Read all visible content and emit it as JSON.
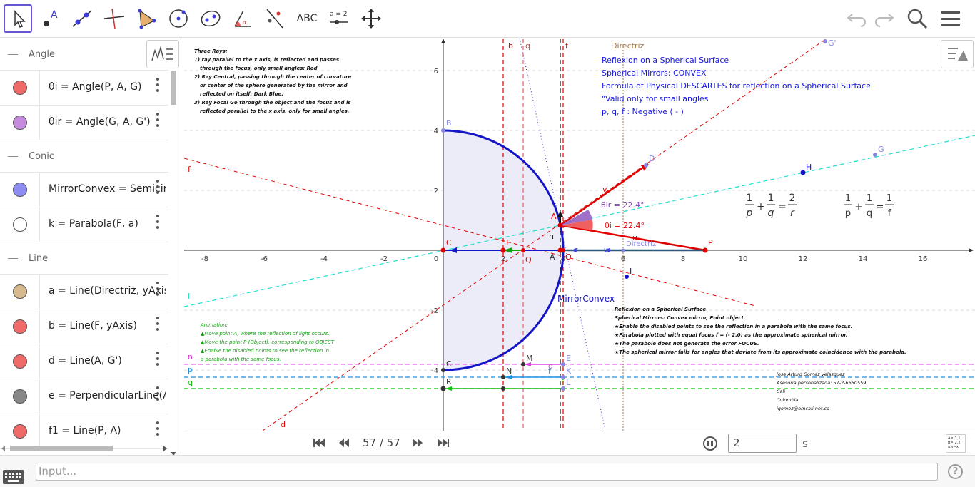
{
  "toolbar": {
    "tools": [
      "move",
      "point",
      "line",
      "perpendicular",
      "polygon",
      "circle",
      "ellipse",
      "angle",
      "reflect",
      "text",
      "slider",
      "move-graphics"
    ],
    "text_tool_label": "ABC",
    "slider_tool_label": "a = 2",
    "point_label": "A"
  },
  "algebra": {
    "groups": [
      {
        "name": "Angle"
      },
      {
        "name": "Conic"
      },
      {
        "name": "Line"
      }
    ],
    "items": [
      {
        "expr": "θi = Angle(P, A, G)",
        "color": "#f06a6a"
      },
      {
        "expr": "θir = Angle(G, A, G')",
        "color": "#c58cdc"
      },
      {
        "expr": "MirrorConvex = Semicircle(B",
        "color": "#8c8cf2"
      },
      {
        "expr": "k = Parabola(F, a)",
        "color": "#ffffff"
      },
      {
        "expr": "a = Line(Directriz, yAxis)",
        "color": "#d7b98e"
      },
      {
        "expr": "b = Line(F, yAxis)",
        "color": "#f06a6a"
      },
      {
        "expr": "d = Line(A, G')",
        "color": "#f06a6a"
      },
      {
        "expr": "e = PerpendicularLine(A, xA",
        "color": "#888888"
      },
      {
        "expr": "f1 = Line(P, A)",
        "color": "#f06a6a"
      }
    ]
  },
  "graphics": {
    "x_ticks": [
      "-8",
      "-6",
      "-4",
      "-2",
      "0",
      "2",
      "4",
      "6",
      "8",
      "10",
      "12",
      "14",
      "16"
    ],
    "y_ticks": [
      "6",
      "4",
      "2",
      "-2",
      "-4"
    ],
    "title_lines": [
      "Reflexion on a Spherical Surface",
      "Spherical Mirrors: CONVEX",
      "Formula of Physical DESCARTES for reflection on a Spherical Surface",
      "\"Valid only for small angles",
      "p, q, f : Negative ( - )"
    ],
    "rays_lines": [
      "Three Rays:",
      "1) ray parallel to the x axis, is reflected and passes",
      "   through the focus, only small angles: Red",
      "2) Ray Central, passing through the center of curvature",
      "   or center of the sphere generated by the mirror and",
      "   reflected on itself: Dark Blue.",
      "3) Ray Focal Go through the object and the focus and is",
      "   reflected parallel to the x axis, only for small angles."
    ],
    "animation_lines": [
      "Animation:",
      "▲Move point A, where the reflection of light occurs.",
      "▲Move the point P (Object), corresponding to OBJECT",
      "▲Enable the disabled points to see the reflection in",
      "  a parabola with the same focus."
    ],
    "note_lines": [
      "Reflexion on a Spherical Surface",
      "Spherical Mirrors: Convex mirror, Point object",
      "★Enable the disabled points to see the reflection in a parabola with the same focus.",
      "★Parabola plotted with equal focus f = (- 2.0) as the approximate spherical mirror.",
      "★The parabole does not generate the error FOCUS.",
      "★The spherical mirror fails for angles that deviate from its approximate coincidence with the parabola."
    ],
    "author_lines": [
      "Jose Arturo Gomez Velasquez",
      "Asesoria personalizada: 57-2-6650559",
      "Cali",
      "Colombia",
      "jgomez@emcali.net.co"
    ],
    "angle_i": "θi = 22.4°",
    "angle_r": "θir = 22.4°",
    "mirror_label": "MirrorConvex",
    "directriz_label": "Directriz",
    "formula1": {
      "a": "1",
      "b": "p",
      "c": "1",
      "d": "q",
      "e": "2",
      "f": "r"
    },
    "formula2": {
      "a": "1",
      "b": "p",
      "c": "1",
      "d": "q",
      "e": "1",
      "f": "f"
    }
  },
  "animation": {
    "counter": "57 / 57",
    "speed": "2",
    "unit": "s"
  },
  "input": {
    "placeholder": "Input..."
  },
  "colors": {
    "accent": "#6557d2",
    "mirror": "#1515c8",
    "ray_red": "#e00000",
    "title_blue": "#1a1ae0",
    "anim_green": "#16a016"
  }
}
